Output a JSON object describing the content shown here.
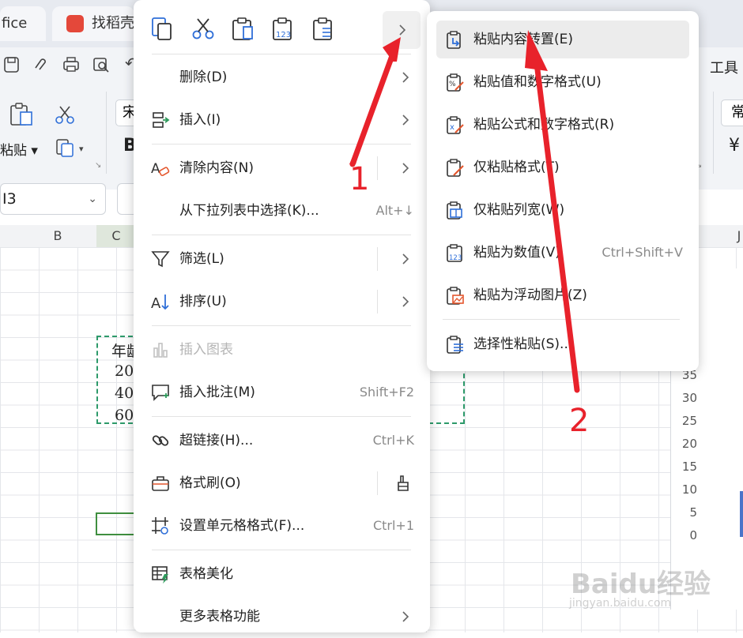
{
  "app": {
    "tabs": [
      {
        "label": "fice"
      },
      {
        "label": "找稻壳"
      }
    ],
    "ribbon": {
      "paste_label": "粘贴",
      "font_box_partial": "宋",
      "bold_partial": "B",
      "right_label": "工具",
      "right_box_partial": "常",
      "right_symbol": "¥"
    },
    "name_box": "I3",
    "columns": [
      "B",
      "C",
      "J"
    ]
  },
  "sheet": {
    "cells": [
      "年龄",
      "20",
      "40",
      "60"
    ]
  },
  "chart_snippet": {
    "y_ticks": [
      "35",
      "30",
      "25",
      "20",
      "15",
      "10",
      "5",
      "0"
    ]
  },
  "context_menu": {
    "toolbar_icons": [
      "copy-icon",
      "cut-icon",
      "paste-icon",
      "paste-values-icon",
      "paste-special-icon"
    ],
    "items": [
      {
        "label": "删除(D)",
        "shortcut": "",
        "submenu": true
      },
      {
        "label": "插入(I)",
        "shortcut": "",
        "submenu": true
      },
      {
        "label": "清除内容(N)",
        "shortcut": "",
        "submenu": true
      },
      {
        "label": "从下拉列表中选择(K)...",
        "shortcut": "Alt+↓",
        "submenu": false
      },
      {
        "label": "筛选(L)",
        "shortcut": "",
        "submenu": true
      },
      {
        "label": "排序(U)",
        "shortcut": "",
        "submenu": true
      },
      {
        "label": "插入图表",
        "shortcut": "",
        "submenu": false,
        "disabled": true
      },
      {
        "label": "插入批注(M)",
        "shortcut": "Shift+F2",
        "submenu": false
      },
      {
        "label": "超链接(H)...",
        "shortcut": "Ctrl+K",
        "submenu": false
      },
      {
        "label": "格式刷(O)",
        "shortcut": "",
        "submenu": false
      },
      {
        "label": "设置单元格格式(F)...",
        "shortcut": "Ctrl+1",
        "submenu": false
      },
      {
        "label": "表格美化",
        "shortcut": "",
        "submenu": false
      },
      {
        "label": "更多表格功能",
        "shortcut": "",
        "submenu": true
      }
    ]
  },
  "paste_submenu": {
    "items": [
      {
        "label": "粘贴内容转置(E)",
        "shortcut": ""
      },
      {
        "label": "粘贴值和数字格式(U)",
        "shortcut": ""
      },
      {
        "label": "粘贴公式和数字格式(R)",
        "shortcut": ""
      },
      {
        "label": "仅粘贴格式(T)",
        "shortcut": ""
      },
      {
        "label": "仅粘贴列宽(W)",
        "shortcut": ""
      },
      {
        "label": "粘贴为数值(V)",
        "shortcut": "Ctrl+Shift+V"
      },
      {
        "label": "粘贴为浮动图片(Z)",
        "shortcut": ""
      },
      {
        "label": "选择性粘贴(S)...",
        "shortcut": ""
      }
    ]
  },
  "annotations": {
    "step1": "1",
    "step2": "2"
  },
  "watermark": {
    "brand": "Baidu经验",
    "url": "jingyan.baidu.com"
  },
  "colors": {
    "annotation": "#e8222b",
    "accent_blue": "#2f6fd8",
    "accent_orange": "#e4572e",
    "copy_border": "#2d9a6a"
  }
}
